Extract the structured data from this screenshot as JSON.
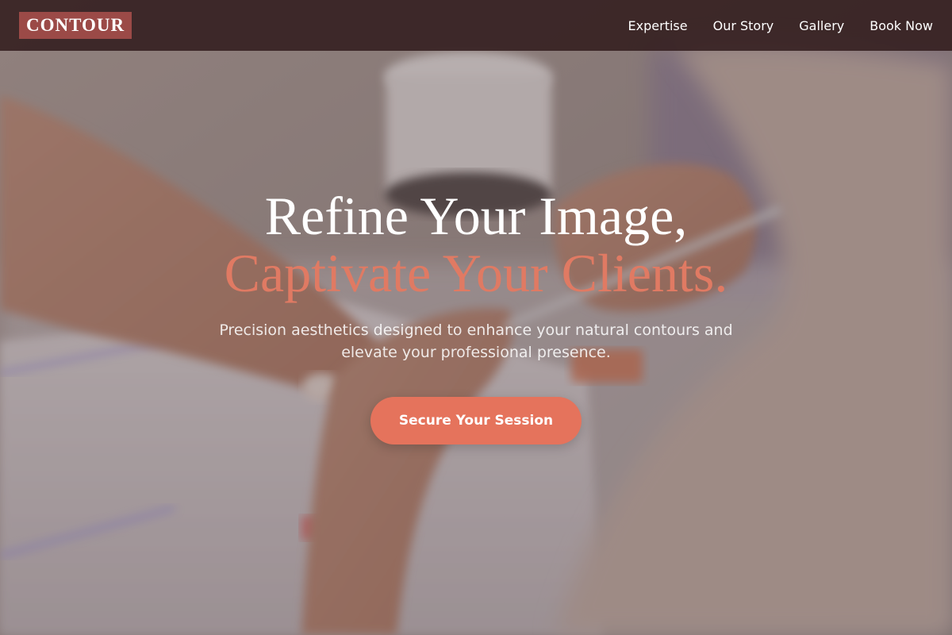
{
  "brand": {
    "logo_text": "CONTOUR",
    "accent_color": "#e5735c",
    "logo_bg_color": "#9b4a47"
  },
  "nav": {
    "items": [
      {
        "label": "Expertise"
      },
      {
        "label": "Our Story"
      },
      {
        "label": "Gallery"
      },
      {
        "label": "Book Now"
      }
    ]
  },
  "hero": {
    "headline_line1": "Refine Your Image,",
    "headline_line2": "Captivate Your Clients.",
    "subtitle": "Precision aesthetics designed to enhance your natural contours and elevate your professional presence.",
    "cta_label": "Secure Your Session",
    "background_image": "nail-technician-manicure-photo"
  }
}
